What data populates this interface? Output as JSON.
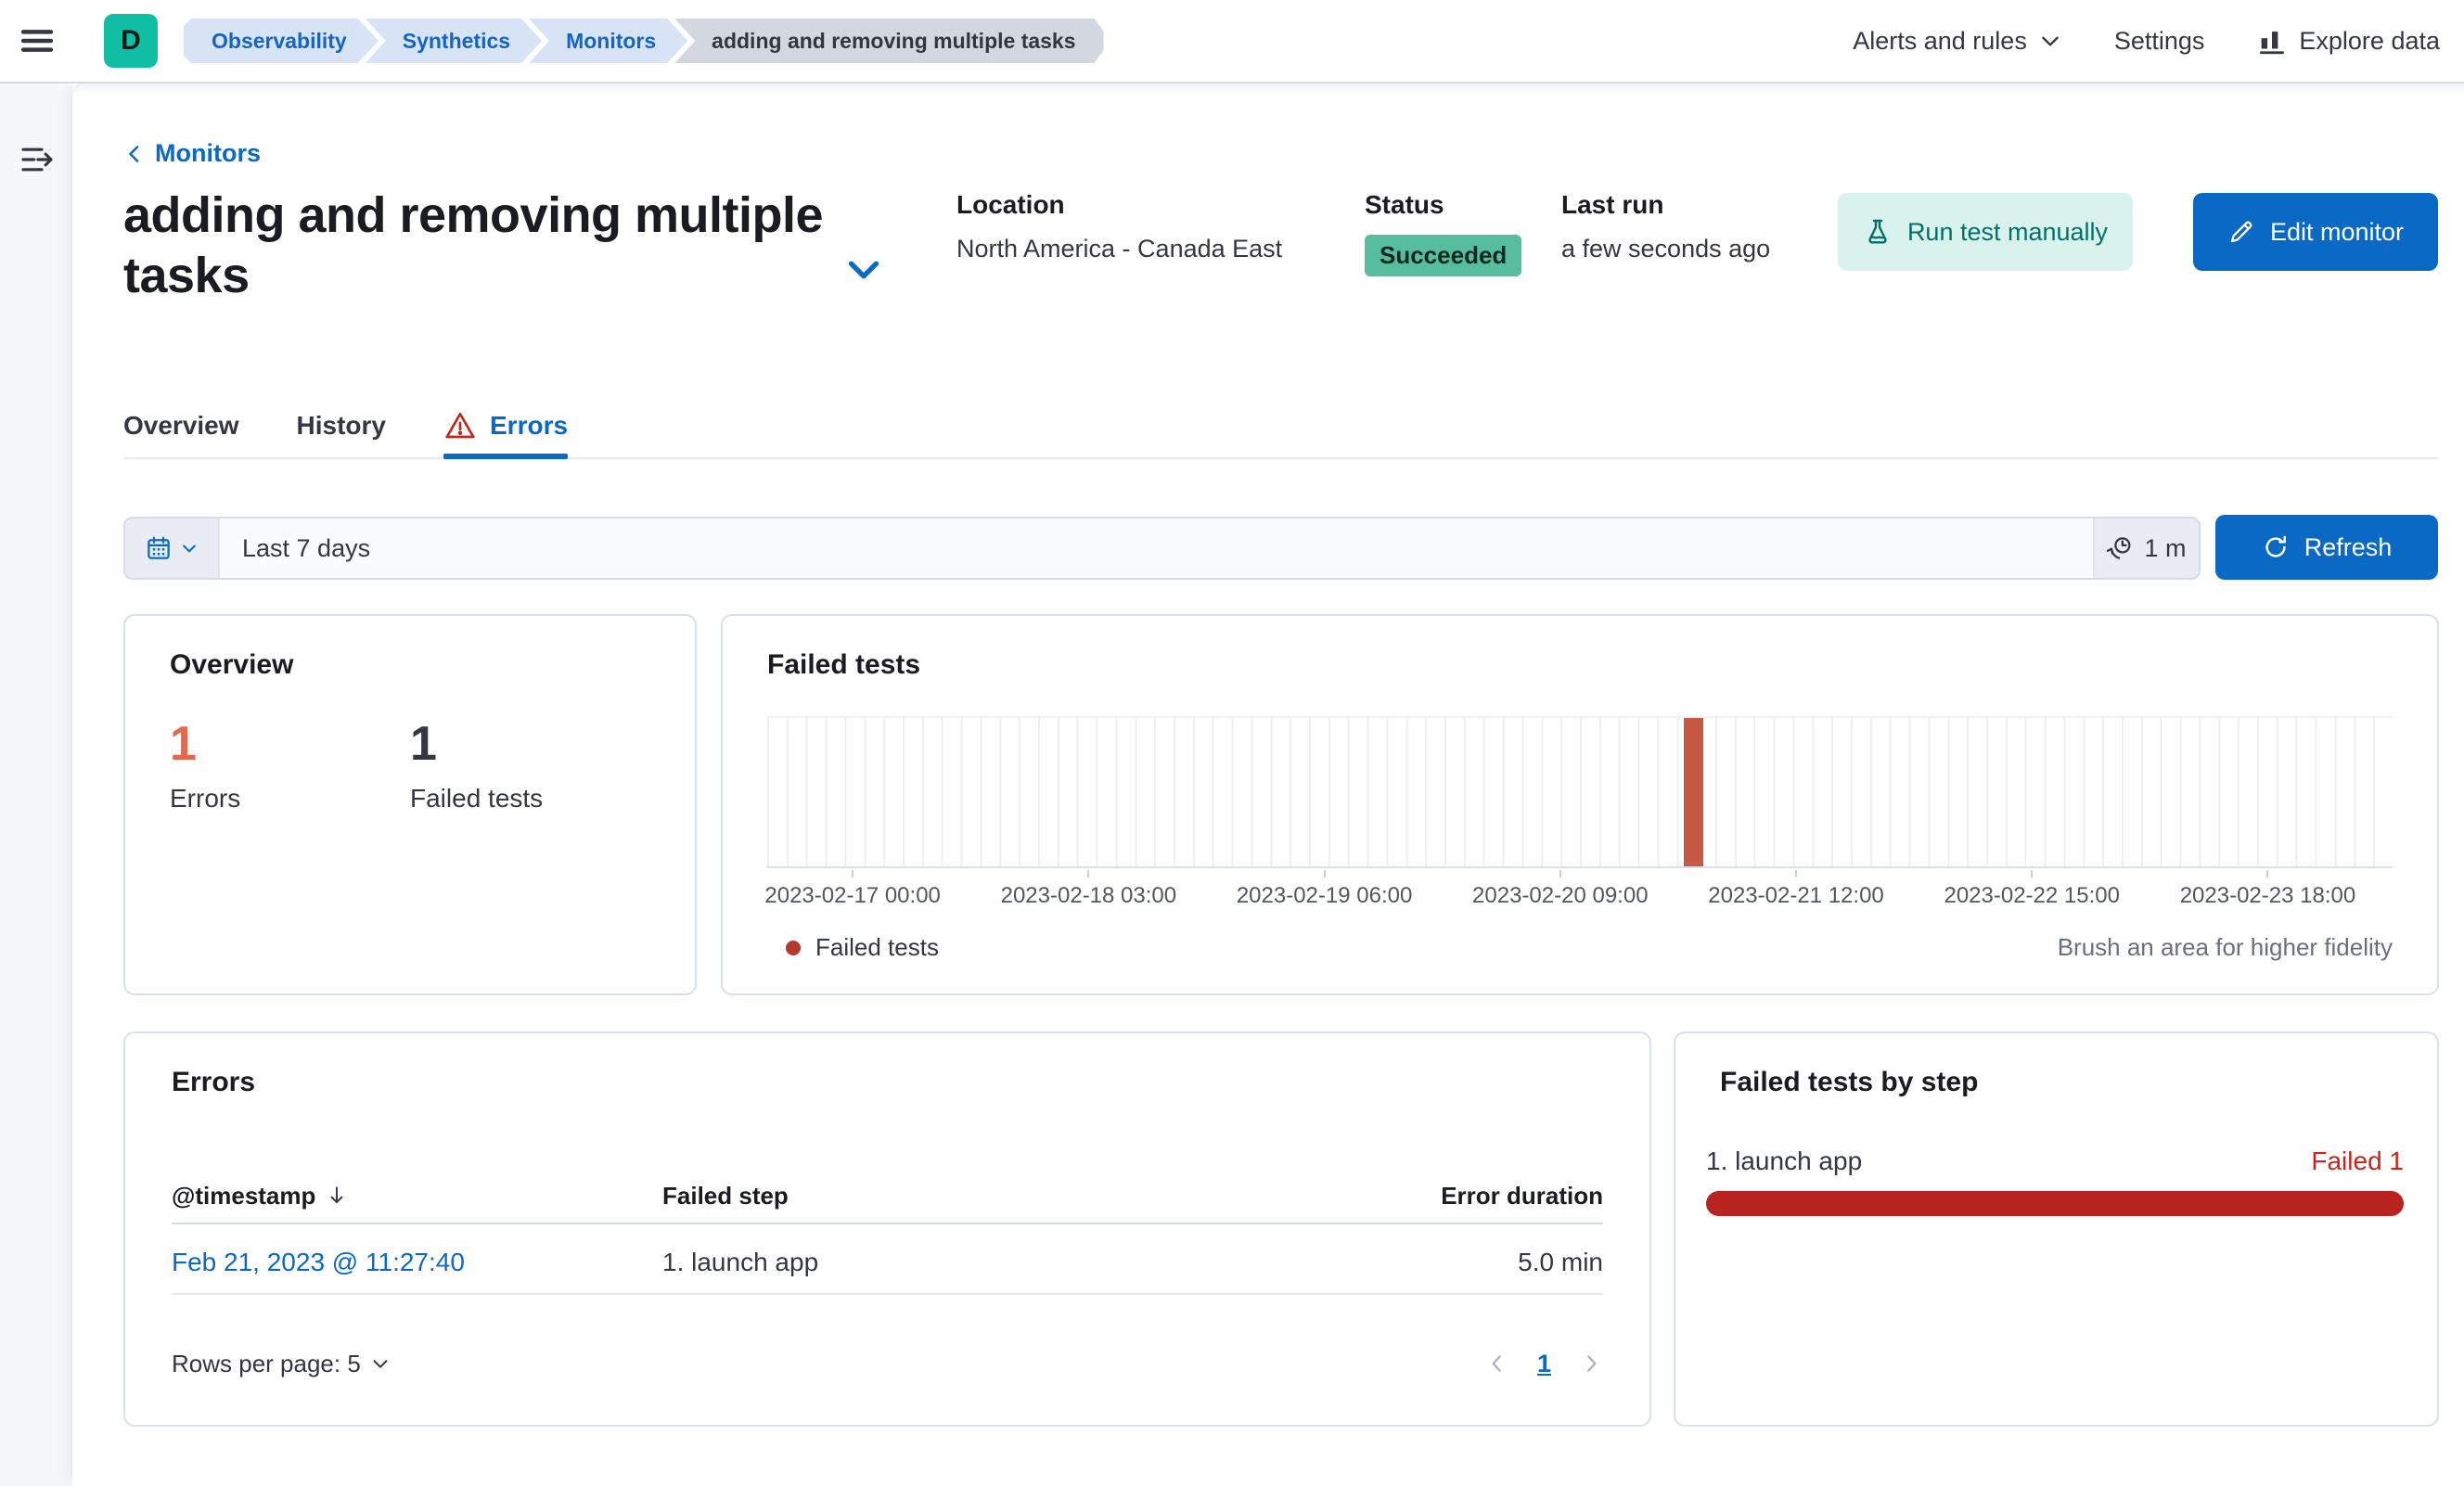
{
  "header": {
    "space_initial": "D",
    "breadcrumbs": [
      {
        "label": "Observability"
      },
      {
        "label": "Synthetics"
      },
      {
        "label": "Monitors"
      },
      {
        "label": "adding and removing multiple tasks"
      }
    ],
    "nav_right": {
      "alerts_menu": "Alerts and rules",
      "settings": "Settings",
      "explore_data": "Explore data"
    }
  },
  "page_header": {
    "back_link": "Monitors",
    "title": "adding and removing multiple tasks",
    "meta": {
      "location_label": "Location",
      "location_value": "North America - Canada East",
      "status_label": "Status",
      "status_value": "Succeeded",
      "last_run_label": "Last run",
      "last_run_value": "a few seconds ago"
    },
    "actions": {
      "run_test": "Run test manually",
      "edit_monitor": "Edit monitor"
    }
  },
  "tabs": [
    {
      "label": "Overview",
      "selected": false
    },
    {
      "label": "History",
      "selected": false
    },
    {
      "label": "Errors",
      "selected": true,
      "warning": true
    }
  ],
  "toolbar": {
    "date_range": "Last 7 days",
    "refresh_interval": "1 m",
    "refresh_button": "Refresh"
  },
  "overview_panel": {
    "title": "Overview",
    "metrics": [
      {
        "value": "1",
        "label": "Errors",
        "color": "#E7664C"
      },
      {
        "value": "1",
        "label": "Failed tests",
        "color": "#343741"
      }
    ]
  },
  "chart_data": {
    "type": "bar",
    "title": "Failed tests",
    "x_ticks": [
      "2023-02-17 00:00",
      "2023-02-18 03:00",
      "2023-02-19 06:00",
      "2023-02-20 09:00",
      "2023-02-21 12:00",
      "2023-02-22 15:00",
      "2023-02-23 18:00"
    ],
    "series": [
      {
        "name": "Failed tests",
        "points": [
          {
            "x": "2023-02-21 11:27",
            "y": 1
          }
        ]
      }
    ],
    "ylim": [
      0,
      1
    ],
    "grid": true,
    "legend_label": "Failed tests",
    "legend_position": "bottom-left",
    "brush_hint": "Brush an area for higher fidelity",
    "bar_color": "#C65944",
    "legend_dot_color": "#B23A2C",
    "layout": {
      "num_buckets": 84,
      "first_tick_pct": 5.26,
      "tick_step_pct": 14.51,
      "bar_left_pct": 56.4,
      "bar_width_pct": 1.2
    }
  },
  "errors_panel": {
    "title": "Errors",
    "columns": [
      "@timestamp",
      "Failed step",
      "Error duration"
    ],
    "rows": [
      {
        "timestamp": "Feb 21, 2023 @ 11:27:40",
        "failed_step": "1. launch app",
        "error_duration": "5.0 min"
      }
    ],
    "pagination": {
      "rows_per_page": "Rows per page: 5",
      "page": "1"
    }
  },
  "failed_by_step_panel": {
    "title": "Failed tests by step",
    "steps": [
      {
        "label": "1. launch app",
        "status": "Failed 1",
        "fraction": 1
      }
    ]
  }
}
